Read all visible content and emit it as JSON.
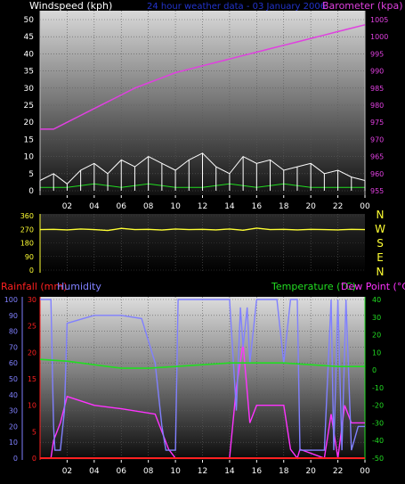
{
  "page": {
    "header_title": "24 hour weather data - 03 January 2006"
  },
  "colors": {
    "background": "#000000",
    "wind_axis": "#ffffff",
    "baro": "#e040e0",
    "direction": "#ffff33",
    "rainfall": "#ff2020",
    "humidity": "#8080ff",
    "temperature": "#22dd22",
    "dewpoint": "#ff33ff"
  },
  "chart_data": [
    {
      "id": "wind_baro",
      "type": "line",
      "title": "24 hour weather data - 03 January 2006",
      "left_axis": {
        "label": "Windspeed (kph)",
        "ticks": [
          "0",
          "5",
          "10",
          "15",
          "20",
          "25",
          "30",
          "35",
          "40",
          "45",
          "50"
        ],
        "ylim": [
          0,
          50
        ]
      },
      "right_axis": {
        "label": "Barometer (kpa)",
        "ticks": [
          "955",
          "960",
          "965",
          "970",
          "975",
          "980",
          "985",
          "990",
          "995",
          "1000",
          "1005"
        ],
        "ylim": [
          955,
          1005
        ]
      },
      "x_ticks": [
        "02",
        "04",
        "06",
        "08",
        "10",
        "12",
        "14",
        "16",
        "18",
        "20",
        "22",
        "00"
      ],
      "x_range_hours": [
        0,
        24
      ],
      "series": [
        {
          "name": "Barometer (kpa)",
          "axis": "right",
          "x": [
            0,
            1,
            2,
            3,
            4,
            5,
            6,
            7,
            8,
            9,
            10,
            11,
            12,
            13,
            14,
            15,
            16,
            17,
            18,
            19,
            20,
            21,
            22,
            23,
            24
          ],
          "values": [
            973,
            973,
            975,
            977,
            979,
            981,
            983,
            985,
            986.5,
            988,
            989.5,
            990.5,
            991.5,
            992.5,
            993.5,
            994.5,
            995.5,
            996.5,
            997.5,
            998.5,
            999.5,
            1000.5,
            1001.5,
            1002.5,
            1003.5
          ]
        },
        {
          "name": "Windspeed (kph)",
          "axis": "left",
          "x": [
            0,
            1,
            2,
            3,
            4,
            5,
            6,
            7,
            8,
            9,
            10,
            11,
            12,
            13,
            14,
            15,
            16,
            17,
            18,
            19,
            20,
            21,
            22,
            23,
            24
          ],
          "values": [
            3,
            5,
            2,
            6,
            8,
            5,
            9,
            7,
            10,
            8,
            6,
            9,
            11,
            7,
            5,
            10,
            8,
            9,
            6,
            7,
            8,
            5,
            6,
            4,
            3
          ]
        },
        {
          "name": "Windspeed low",
          "axis": "left",
          "x": [
            0,
            2,
            4,
            6,
            8,
            10,
            12,
            14,
            16,
            18,
            20,
            22,
            24
          ],
          "values": [
            1,
            1,
            2,
            1,
            2,
            1,
            1,
            2,
            1,
            2,
            1,
            1,
            1
          ]
        }
      ]
    },
    {
      "id": "direction",
      "type": "line",
      "left_axis": {
        "ticks": [
          "0",
          "90",
          "180",
          "270",
          "360"
        ],
        "ylim": [
          0,
          360
        ]
      },
      "right_labels": [
        "N",
        "W",
        "S",
        "E",
        "N"
      ],
      "x_range_hours": [
        0,
        24
      ],
      "series": [
        {
          "name": "Wind direction",
          "x": [
            0,
            1,
            2,
            3,
            4,
            5,
            6,
            7,
            8,
            9,
            10,
            11,
            12,
            13,
            14,
            15,
            16,
            17,
            18,
            19,
            20,
            21,
            22,
            23,
            24
          ],
          "values": [
            268,
            270,
            266,
            272,
            268,
            262,
            276,
            268,
            270,
            265,
            272,
            268,
            270,
            266,
            272,
            264,
            278,
            268,
            270,
            266,
            270,
            268,
            266,
            270,
            268
          ]
        }
      ]
    },
    {
      "id": "rain_hum_temp",
      "type": "line",
      "labels": {
        "rainfall": "Rainfall (mm)",
        "humidity": "Humidity",
        "temperature": "Temperature (°C)",
        "dewpoint": "Dew Point (°C)"
      },
      "left_axis": {
        "ticks": [
          "0",
          "10",
          "20",
          "30",
          "40",
          "50",
          "60",
          "70",
          "80",
          "90",
          "100"
        ],
        "ylim": [
          0,
          100
        ]
      },
      "rain_axis": {
        "ticks": [
          "0",
          "5",
          "10",
          "15",
          "20",
          "25",
          "30"
        ],
        "ylim": [
          0,
          30
        ]
      },
      "right_axis": {
        "ticks": [
          "-50",
          "-40",
          "-30",
          "-20",
          "-10",
          "0",
          "10",
          "20",
          "30",
          "40"
        ],
        "ylim": [
          -50,
          40
        ]
      },
      "x_ticks": [
        "02",
        "04",
        "06",
        "08",
        "10",
        "12",
        "14",
        "16",
        "18",
        "20",
        "22",
        "00"
      ],
      "x_range_hours": [
        0,
        24
      ],
      "series": [
        {
          "name": "Humidity",
          "x": [
            0,
            0.8,
            1.0,
            1.1,
            1.5,
            1.8,
            2.0,
            4.0,
            6.0,
            7.5,
            8.5,
            9.0,
            9.3,
            9.5,
            10.0,
            10.2,
            14.0,
            14.5,
            14.8,
            15.0,
            15.3,
            15.5,
            16.0,
            17.5,
            18.0,
            18.5,
            19.0,
            19.2,
            21.0,
            21.5,
            21.7,
            22.0,
            22.3,
            22.6,
            23.0,
            23.5,
            24.0
          ],
          "values": [
            100,
            100,
            20,
            5,
            5,
            30,
            85,
            90,
            90,
            88,
            60,
            20,
            5,
            5,
            5,
            100,
            100,
            30,
            95,
            70,
            95,
            60,
            100,
            100,
            60,
            100,
            100,
            5,
            5,
            100,
            5,
            100,
            5,
            100,
            5,
            20,
            20
          ]
        },
        {
          "name": "Temperature",
          "x": [
            0,
            2,
            4,
            6,
            8,
            10,
            12,
            14,
            16,
            18,
            20,
            22,
            24
          ],
          "values": [
            6,
            5,
            3,
            1,
            1,
            2,
            3,
            4,
            4,
            4,
            3,
            2,
            2
          ]
        },
        {
          "name": "Dew Point",
          "x": [
            0,
            0.8,
            1.0,
            1.5,
            2.0,
            4.0,
            6.0,
            8.5,
            9.0,
            9.5,
            10.0,
            14.0,
            14.5,
            15.0,
            15.5,
            16.0,
            18.0,
            18.5,
            19.0,
            19.2,
            21.0,
            21.5,
            22.0,
            22.5,
            23.0,
            24.0
          ],
          "values": [
            -50,
            -50,
            -40,
            -30,
            -15,
            -20,
            -22,
            -25,
            -35,
            -45,
            -50,
            -50,
            -10,
            15,
            -30,
            -20,
            -20,
            -45,
            -50,
            -45,
            -50,
            -25,
            -50,
            -20,
            -30,
            -30
          ]
        },
        {
          "name": "Rainfall",
          "x": [
            0,
            24
          ],
          "values": [
            0,
            0
          ]
        }
      ]
    }
  ]
}
